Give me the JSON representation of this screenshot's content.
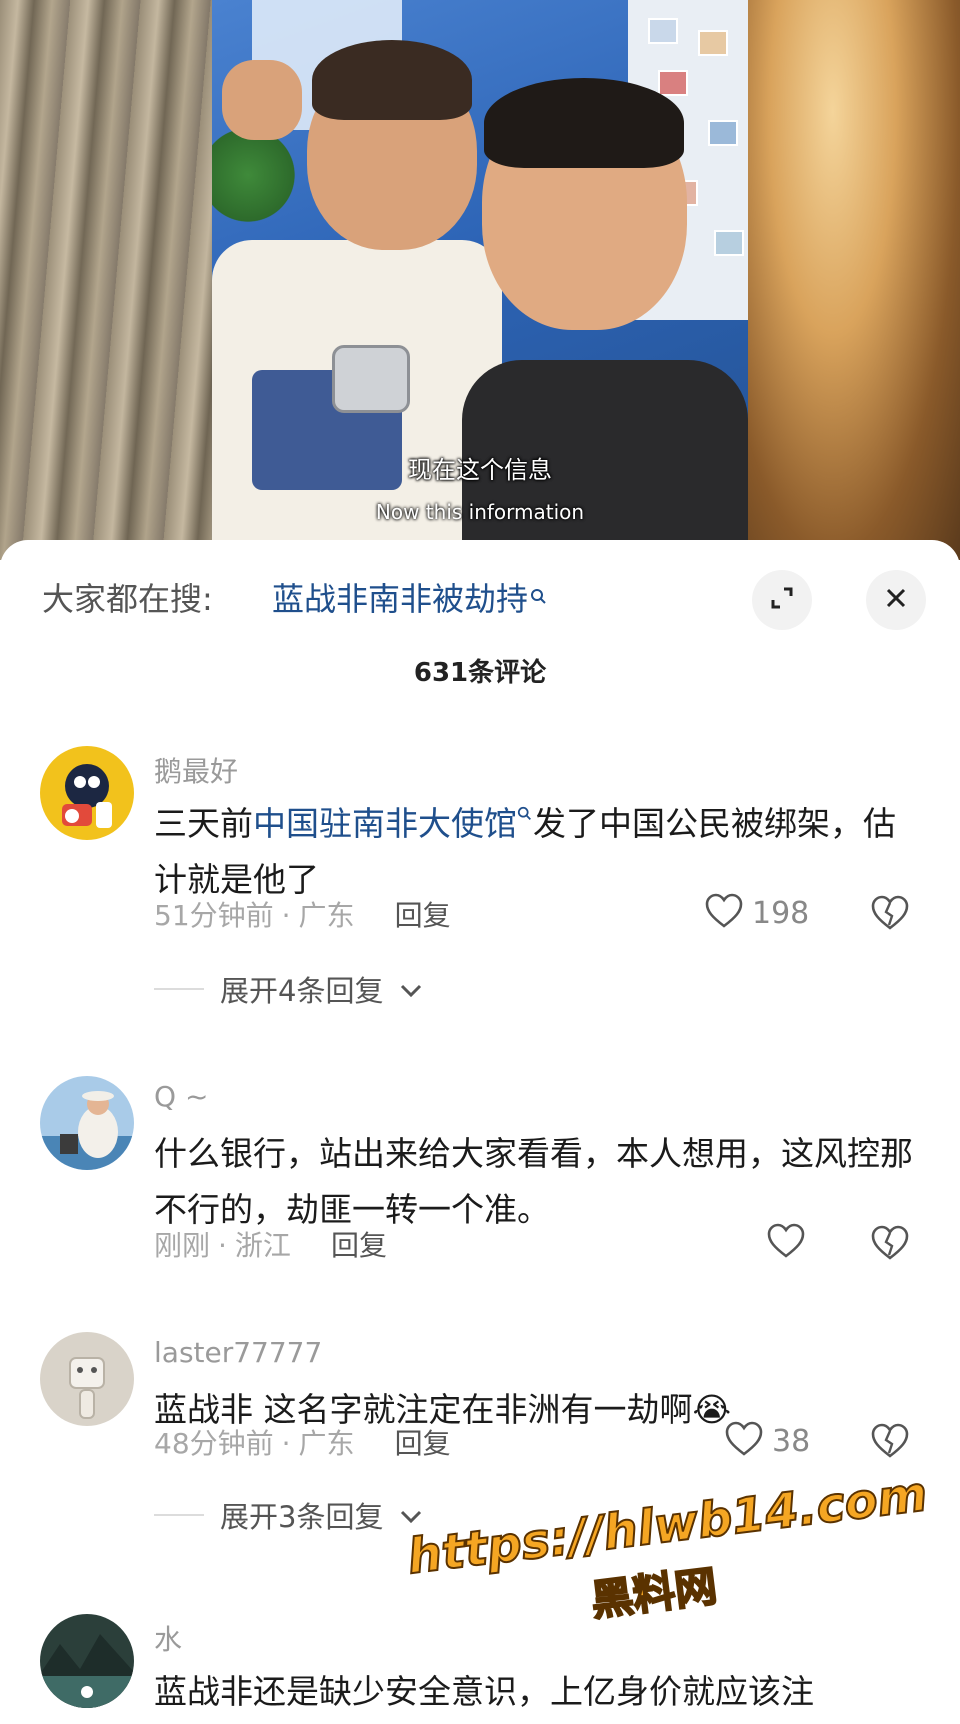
{
  "video": {
    "subtitle_zh": "现在这个信息",
    "subtitle_en": "Now this information"
  },
  "search": {
    "prefix": "大家都在搜:",
    "term": "蓝战非南非被劫持"
  },
  "comments_header": {
    "count_label": "631条评论"
  },
  "comments": [
    {
      "username": "鹅最好",
      "text_before_link": "三天前",
      "link": "中国驻南非大使馆",
      "text_after_link": "发了中国公民被绑架，估计就是他了",
      "time": "51分钟前",
      "location": "广东",
      "reply_label": "回复",
      "likes": "198",
      "expand_label": "展开4条回复"
    },
    {
      "username": "Q ~",
      "text": "什么银行，站出来给大家看看，本人想用，这风控那不行的，劫匪一转一个准。",
      "time": "刚刚",
      "location": "浙江",
      "reply_label": "回复",
      "likes": ""
    },
    {
      "username": "laster77777",
      "text": "蓝战非 这名字就注定在非洲有一劫啊",
      "emoji": "😭",
      "time": "48分钟前",
      "location": "广东",
      "reply_label": "回复",
      "likes": "38",
      "expand_label": "展开3条回复"
    },
    {
      "username": "水",
      "text": "蓝战非还是缺少安全意识，上亿身价就应该注"
    }
  ],
  "watermark": {
    "url": "https://hlwb14.com",
    "name": "黑料网"
  },
  "colors": {
    "link": "#1f4f8c",
    "watermark": "#f5a623"
  }
}
